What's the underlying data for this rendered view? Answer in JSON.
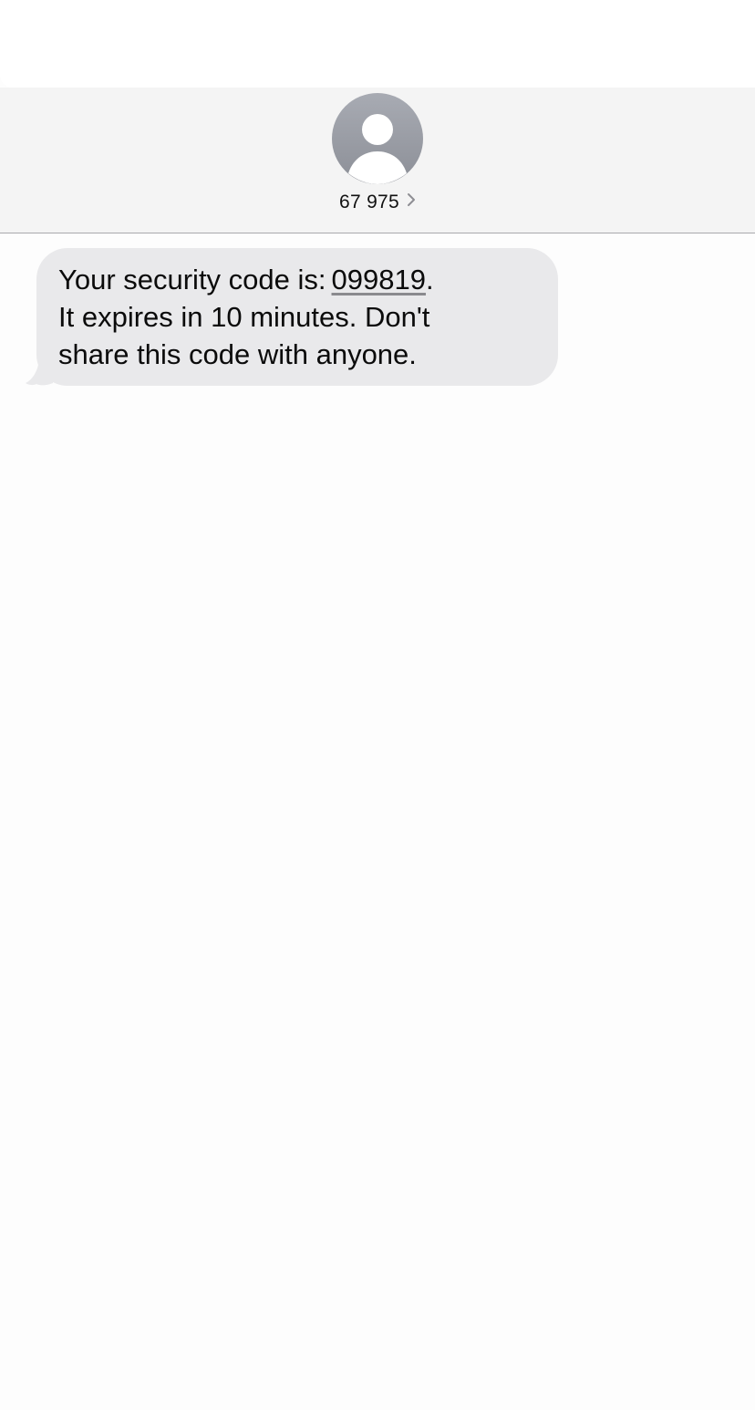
{
  "contact": {
    "name": "67 975",
    "avatar_icon": "person-silhouette-icon",
    "chevron_icon": "chevron-right-icon"
  },
  "message": {
    "prefix": "Your security code is:",
    "code": "099819",
    "suffix": ".",
    "line2": "It expires in 10 minutes. Don't",
    "line3": "share this code with anyone."
  },
  "colors": {
    "bubble": "#e9e9eb",
    "header": "#f4f4f4",
    "avatar": "#9a9da5"
  }
}
